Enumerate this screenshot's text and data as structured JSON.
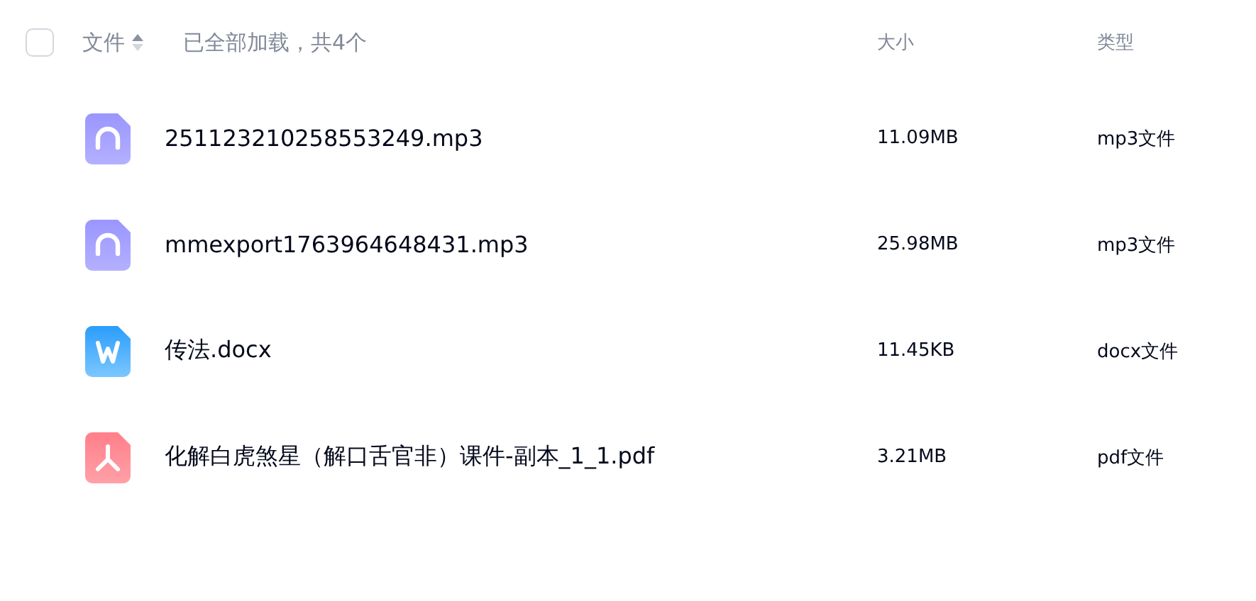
{
  "header": {
    "select_all": {
      "checked": false
    },
    "name_column": "文件",
    "status": "已全部加载，共4个",
    "size_column": "大小",
    "type_column": "类型"
  },
  "files": [
    {
      "kind": "audio",
      "name": "251123210258553249.mp3",
      "size": "11.09MB",
      "type": "mp3文件"
    },
    {
      "kind": "audio",
      "name": "mmexport1763964648431.mp3",
      "size": "25.98MB",
      "type": "mp3文件"
    },
    {
      "kind": "word",
      "name": "传法.docx",
      "size": "11.45KB",
      "type": "docx文件"
    },
    {
      "kind": "pdf",
      "name": "化解白虎煞星（解口舌官非）课件-副本_1_1.pdf",
      "size": "3.21MB",
      "type": "pdf文件"
    }
  ]
}
